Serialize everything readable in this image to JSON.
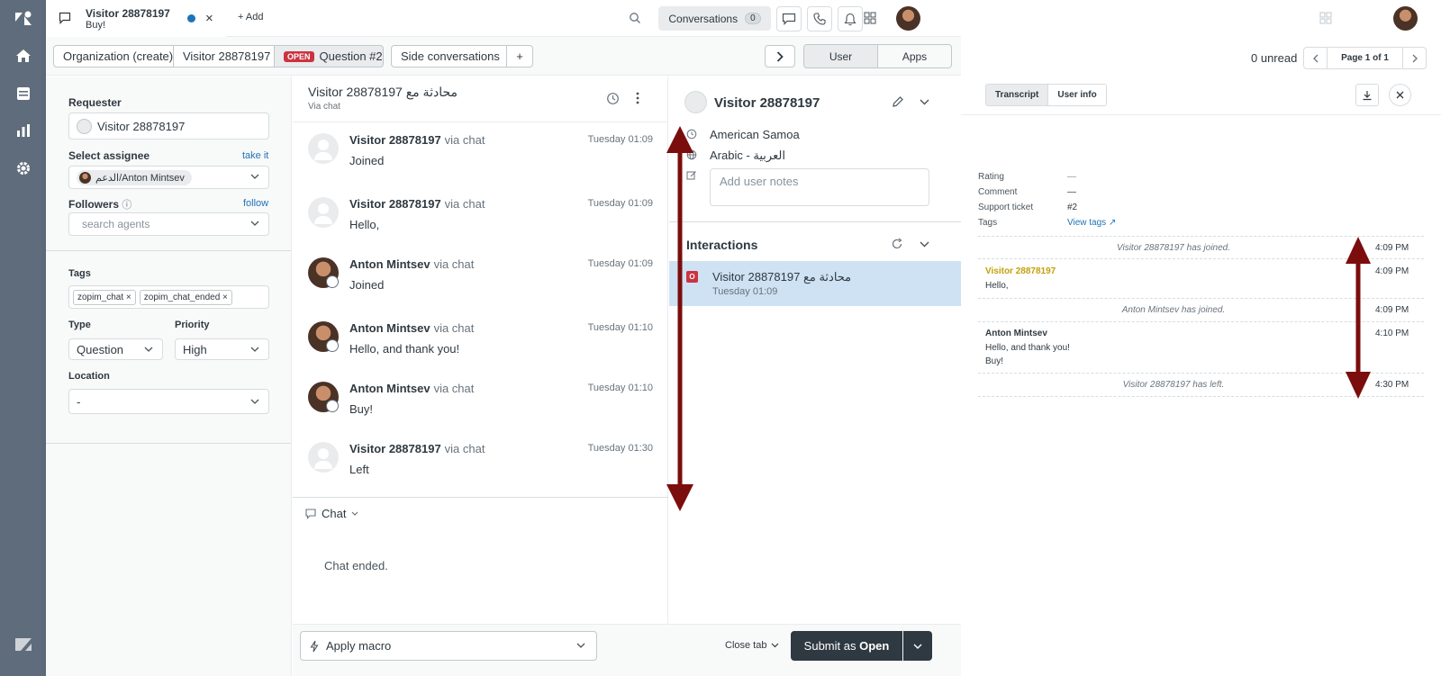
{
  "colors": {
    "nav_bg": "#5f6c7b",
    "brand_dark": "#2f3941",
    "link": "#1f73b7",
    "open_badge": "#cc3340",
    "visitor_name": "#c2a10b",
    "arrow": "#7b0d0d"
  },
  "tab": {
    "title": "Visitor 28878197",
    "subtitle": "Buy!",
    "add_label": "Add"
  },
  "topbar": {
    "conversations_label": "Conversations",
    "conversations_count": "0"
  },
  "toolbar": {
    "crumbs": [
      "Organization (create)",
      "Visitor 28878197",
      "Question #2",
      "Side conversations"
    ],
    "open_badge": "OPEN",
    "segment": [
      "User",
      "Apps"
    ]
  },
  "props": {
    "requester_label": "Requester",
    "requester_value": "Visitor 28878197",
    "assignee_label": "Select assignee",
    "take_it": "take it",
    "assignee_value": "الدعم/Anton Mintsev",
    "followers_label": "Followers",
    "follow": "follow",
    "followers_placeholder": "search agents",
    "tags_label": "Tags",
    "tags": [
      "zopim_chat",
      "zopim_chat_ended"
    ],
    "type_label": "Type",
    "type_value": "Question",
    "priority_label": "Priority",
    "priority_value": "High",
    "location_label": "Location",
    "location_value": "-"
  },
  "conversation": {
    "title": "Visitor 28878197 محادثة مع",
    "subtitle": "Via chat",
    "messages": [
      {
        "author": "Visitor 28878197",
        "via": "via chat",
        "time": "Tuesday 01:09",
        "body": "Joined"
      },
      {
        "author": "Visitor 28878197",
        "via": "via chat",
        "time": "Tuesday 01:09",
        "body": "Hello,"
      },
      {
        "author": "Anton Mintsev",
        "via": "via chat",
        "time": "Tuesday 01:09",
        "body": "Joined"
      },
      {
        "author": "Anton Mintsev",
        "via": "via chat",
        "time": "Tuesday 01:10",
        "body": "Hello, and thank you!"
      },
      {
        "author": "Anton Mintsev",
        "via": "via chat",
        "time": "Tuesday 01:10",
        "body": "Buy!"
      },
      {
        "author": "Visitor 28878197",
        "via": "via chat",
        "time": "Tuesday 01:30",
        "body": "Left"
      }
    ],
    "channel_label": "Chat",
    "chat_ended": "Chat ended."
  },
  "bottombar": {
    "apply_macro": "Apply macro",
    "close_tab": "Close tab",
    "submit_prefix": "Submit as ",
    "submit_status": "Open"
  },
  "context": {
    "name": "Visitor 28878197",
    "location": "American Samoa",
    "language": "Arabic - العربية",
    "notes_placeholder": "Add user notes",
    "interactions_label": "Interactions",
    "interaction_title": "Visitor 28878197 محادثة مع",
    "interaction_time": "Tuesday 01:09",
    "interaction_icon_letter": "O"
  },
  "transcript": {
    "unread": "0 unread",
    "page": "Page 1 of 1",
    "tabs": [
      "Transcript",
      "User info"
    ],
    "meta": [
      {
        "key": "Rating",
        "value": "—"
      },
      {
        "key": "Comment",
        "value": "—"
      },
      {
        "key": "Support ticket",
        "value": "#2"
      },
      {
        "key": "Tags",
        "value": "View tags"
      }
    ],
    "events": [
      {
        "system": "Visitor 28878197 has joined.",
        "time": "4:09 PM"
      },
      {
        "author": "Visitor 28878197",
        "text": [
          "Hello,"
        ],
        "time": "4:09 PM"
      },
      {
        "system": "Anton Mintsev has joined.",
        "time": "4:09 PM"
      },
      {
        "author": "Anton Mintsev",
        "text": [
          "Hello, and thank you!",
          "Buy!"
        ],
        "time": "4:10 PM"
      },
      {
        "system": "Visitor 28878197 has left.",
        "time": "4:30 PM"
      }
    ]
  }
}
